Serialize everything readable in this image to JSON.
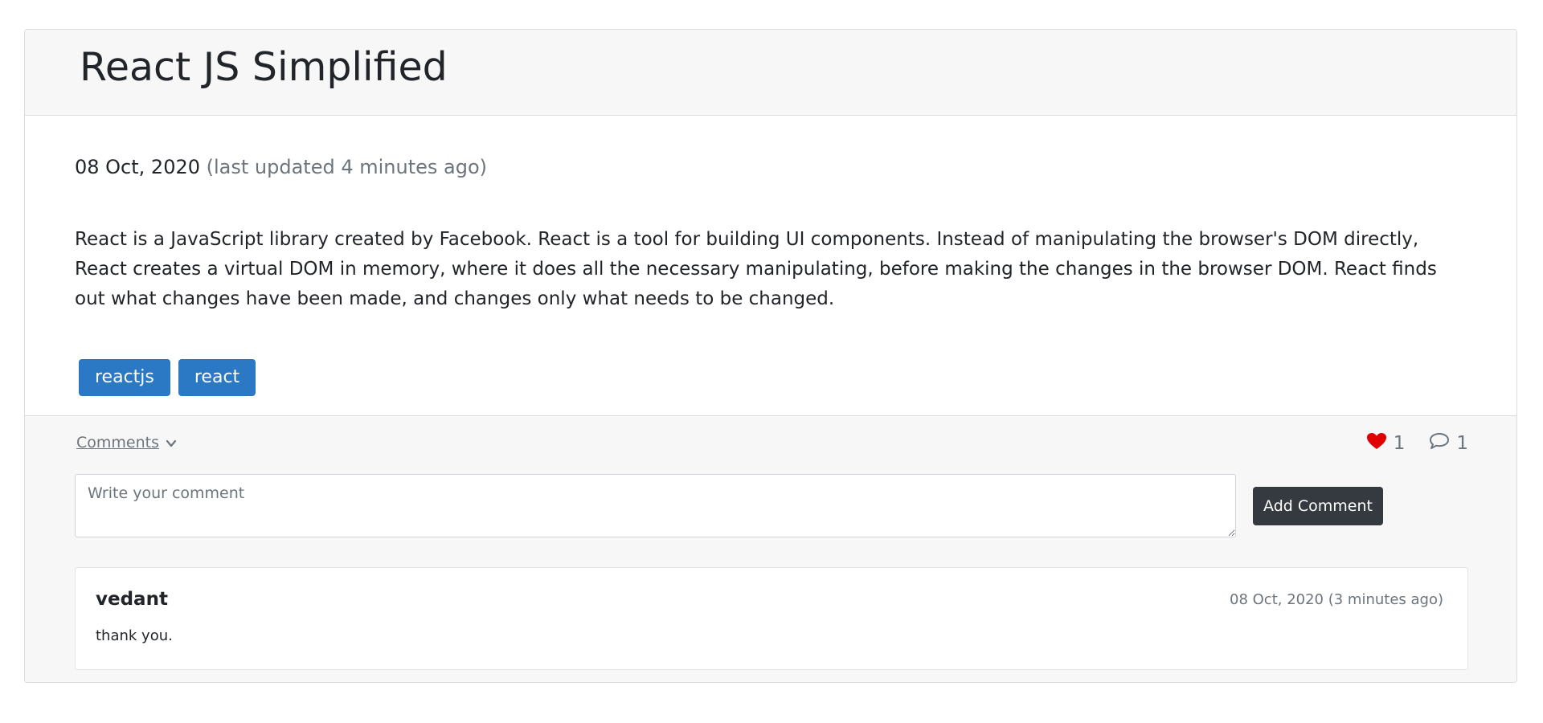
{
  "post": {
    "title": "React JS Simplified",
    "date": "08 Oct, 2020",
    "updated": "(last updated 4 minutes ago)",
    "body": "React is a JavaScript library created by Facebook. React is a tool for building UI components. Instead of manipulating the browser's DOM directly, React creates a virtual DOM in memory, where it does all the necessary manipulating, before making the changes in the browser DOM. React finds out what changes have been made, and changes only what needs to be changed.",
    "tags": [
      "reactjs",
      "react"
    ]
  },
  "footer": {
    "comments_label": "Comments",
    "likes": "1",
    "comment_count": "1",
    "input_placeholder": "Write your comment",
    "add_button": "Add Comment"
  },
  "comments": [
    {
      "author": "vedant",
      "date": "08 Oct, 2020 (3 minutes ago)",
      "text": "thank you."
    }
  ],
  "colors": {
    "tag_bg": "#2b78c5",
    "button_bg": "#343a40",
    "heart": "#e00000",
    "muted": "#6c757d"
  },
  "icons": {
    "toggle": "chevron-down-icon",
    "like": "heart-icon",
    "comment": "speech-bubble-icon"
  }
}
